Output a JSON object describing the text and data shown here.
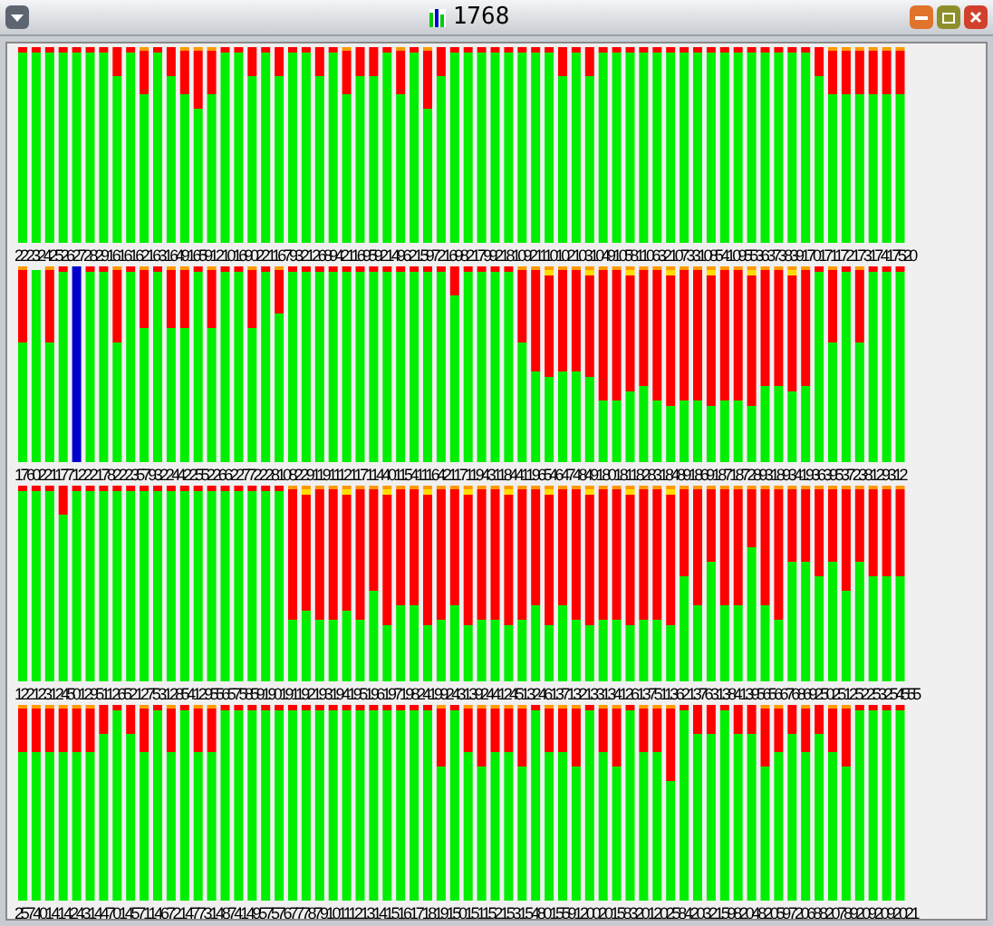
{
  "window": {
    "title": "1768"
  },
  "panels": [
    {
      "labels": "22232425262728291616162163164916591210169022116793212689421169592149621597216982179921810921110102103104910581106321073310854109553637383917017117217317417520"
    },
    {
      "labels": "17602211771222178222357932244225522662277222810822911911121171144011541116421171194311844119654647484918018118283184891869187187289318934193639537238129312"
    },
    {
      "labels": "1221231245012951126521275312854129556575859190191192193194195196197198241992431392441245132461371321331341261375113621376313841395656676869250251252253254555"
    },
    {
      "labels": "2574014142431447014571146721477314874149575767778791011121314151617181915015115215315480155912002015832012025842032159820482059720688207892092092021"
    }
  ]
}
